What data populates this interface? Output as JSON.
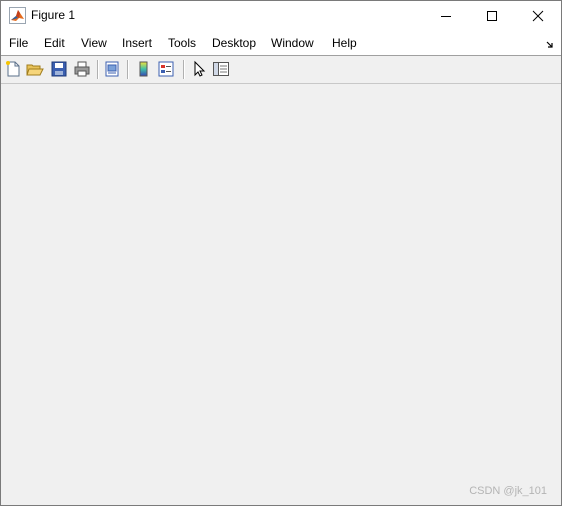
{
  "window": {
    "title": "Figure 1"
  },
  "menu": {
    "items": [
      "File",
      "Edit",
      "View",
      "Insert",
      "Tools",
      "Desktop",
      "Window",
      "Help"
    ]
  },
  "toolbar": {
    "icons": [
      "new-figure-icon",
      "open-file-icon",
      "save-icon",
      "print-icon",
      "print-preview-icon",
      "colorbar-icon",
      "legend-icon",
      "pointer-icon",
      "property-editor-icon"
    ]
  },
  "watermark": {
    "text": "CSDN @jk_101"
  },
  "colors": {
    "canvas": "#f0f0f0",
    "toolbar": "#f0f0f0",
    "titlebar": "#ffffff"
  }
}
